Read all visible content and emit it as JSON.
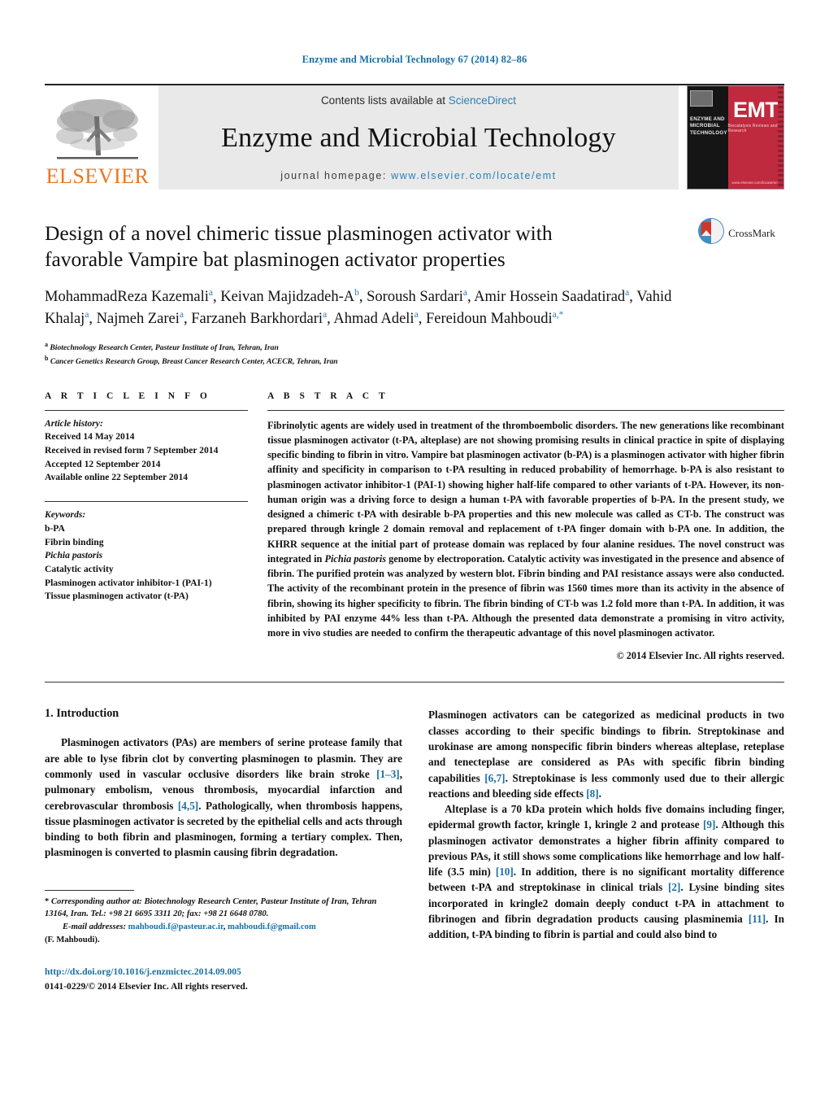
{
  "running_head": "Enzyme and Microbial Technology 67 (2014) 82–86",
  "masthead": {
    "elsevier_wordmark": "ELSEVIER",
    "contents_prefix": "Contents lists available at ",
    "contents_link": "ScienceDirect",
    "journal_title": "Enzyme and Microbial Technology",
    "homepage_prefix": "journal homepage: ",
    "homepage_url": "www.elsevier.com/locate/emt",
    "cover": {
      "left_text": "ENZYME AND MICROBIAL TECHNOLOGY",
      "acronym": "EMT",
      "tagline": "Biocatalysis Reviews and Research",
      "bottom_url": "www.elsevier.com/locate/emt"
    },
    "colors": {
      "link": "#2a7fb8",
      "elsevier_orange": "#e87722",
      "cover_red": "#c02a3e",
      "band_gray": "#e9e9e9"
    }
  },
  "crossmark": {
    "label": "CrossMark"
  },
  "article": {
    "title": "Design of a novel chimeric tissue plasminogen activator with favorable Vampire bat plasminogen activator properties",
    "authors_html": "MohammadReza Kazemali<sup>a</sup>, Keivan Majidzadeh-A<sup>b</sup>, Soroush Sardari<sup>a</sup>, Amir Hossein Saadatirad<sup>a</sup>, Vahid Khalaj<sup>a</sup>, Najmeh Zarei<sup>a</sup>, Farzaneh Barkhordari<sup>a</sup>, Ahmad Adeli<sup>a</sup>, Fereidoun Mahboudi<sup>a,*</sup>",
    "affiliations": [
      {
        "marker": "a",
        "text": "Biotechnology Research Center, Pasteur Institute of Iran, Tehran, Iran"
      },
      {
        "marker": "b",
        "text": "Cancer Genetics Research Group, Breast Cancer Research Center, ACECR, Tehran, Iran"
      }
    ]
  },
  "article_info": {
    "heading": "A R T I C L E   I N F O",
    "history_label": "Article history:",
    "history": [
      "Received 14 May 2014",
      "Received in revised form 7 September 2014",
      "Accepted 12 September 2014",
      "Available online 22 September 2014"
    ],
    "keywords_label": "Keywords:",
    "keywords": [
      "b-PA",
      "Fibrin binding",
      "Pichia pastoris",
      "Catalytic activity",
      "Plasminogen activator inhibitor-1 (PAI-1)",
      "Tissue plasminogen activator (t-PA)"
    ],
    "keywords_italic_index": 2
  },
  "abstract": {
    "heading": "A B S T R A C T",
    "text_part1": "Fibrinolytic agents are widely used in treatment of the thromboembolic disorders. The new generations like recombinant tissue plasminogen activator (t-PA, alteplase) are not showing promising results in clinical practice in spite of displaying specific binding to fibrin in vitro. Vampire bat plasminogen activator (b-PA) is a plasminogen activator with higher fibrin affinity and specificity in comparison to t-PA resulting in reduced probability of hemorrhage. b-PA is also resistant to plasminogen activator inhibitor-1 (PAI-1) showing higher half-life compared to other variants of t-PA. However, its non-human origin was a driving force to design a human t-PA with favorable properties of b-PA. In the present study, we designed a chimeric t-PA with desirable b-PA properties and this new molecule was called as CT-b. The construct was prepared through kringle 2 domain removal and replacement of t-PA finger domain with b-PA one. In addition, the KHRR sequence at the initial part of protease domain was replaced by four alanine residues. The novel construct was integrated in ",
    "italic_species": "Pichia pastoris",
    "text_part2": " genome by electroporation. Catalytic activity was investigated in the presence and absence of fibrin. The purified protein was analyzed by western blot. Fibrin binding and PAI resistance assays were also conducted. The activity of the recombinant protein in the presence of fibrin was 1560 times more than its activity in the absence of fibrin, showing its higher specificity to fibrin. The fibrin binding of CT-b was 1.2 fold more than t-PA. In addition, it was inhibited by PAI enzyme 44% less than t-PA. Although the presented data demonstrate a promising in vitro activity, more in vivo studies are needed to confirm the therapeutic advantage of this novel plasminogen activator.",
    "copyright": "© 2014 Elsevier Inc. All rights reserved."
  },
  "introduction": {
    "section_number_title": "1. Introduction",
    "left_para1_a": "Plasminogen activators (PAs) are members of serine protease family that are able to lyse fibrin clot by converting plasminogen to plasmin. They are commonly used in vascular occlusive disorders like brain stroke ",
    "ref_1_3": "[1–3]",
    "left_para1_b": ", pulmonary embolism, venous thrombosis, myocardial infarction and cerebrovascular thrombosis ",
    "ref_4_5": "[4,5]",
    "left_para1_c": ". Pathologically, when thrombosis happens, tissue plasminogen activator is secreted by the epithelial cells and acts through binding to both fibrin and plasminogen, forming a tertiary complex. Then, plasminogen is converted to plasmin causing fibrin degradation.",
    "right_para1_a": "Plasminogen activators can be categorized as medicinal products in two classes according to their specific bindings to fibrin. Streptokinase and urokinase are among nonspecific fibrin binders whereas alteplase, reteplase and tenecteplase are considered as PAs with specific fibrin binding capabilities ",
    "ref_6_7": "[6,7]",
    "right_para1_b": ". Streptokinase is less commonly used due to their allergic reactions and bleeding side effects ",
    "ref_8": "[8]",
    "right_para1_c": ".",
    "right_para2_a": "Alteplase is a 70 kDa protein which holds five domains including finger, epidermal growth factor, kringle 1, kringle 2 and protease ",
    "ref_9": "[9]",
    "right_para2_b": ". Although this plasminogen activator demonstrates a higher fibrin affinity compared to previous PAs, it still shows some complications like hemorrhage and low half-life (3.5 min) ",
    "ref_10": "[10]",
    "right_para2_c": ". In addition, there is no significant mortality difference between t-PA and streptokinase in clinical trials ",
    "ref_2": "[2]",
    "right_para2_d": ". Lysine binding sites incorporated in kringle2 domain deeply conduct t-PA in attachment to fibrinogen and fibrin degradation products causing plasminemia ",
    "ref_11": "[11]",
    "right_para2_e": ". In addition, t-PA binding to fibrin is partial and could also bind to"
  },
  "footnote": {
    "star": "*",
    "corresponding_text": "Corresponding author at: Biotechnology Research Center, Pasteur Institute of Iran, Tehran 13164, Iran. Tel.: +98 21 6695 3311 20; fax: +98 21 6648 0780.",
    "email_label": "E-mail addresses:",
    "email1": "mahboudi.f@pasteur.ac.ir",
    "email2": "mahboudi.f@gmail.com",
    "email_owner": "(F. Mahboudi)."
  },
  "doi_block": {
    "doi_url": "http://dx.doi.org/10.1016/j.enzmictec.2014.09.005",
    "issn_line": "0141-0229/© 2014 Elsevier Inc. All rights reserved."
  }
}
